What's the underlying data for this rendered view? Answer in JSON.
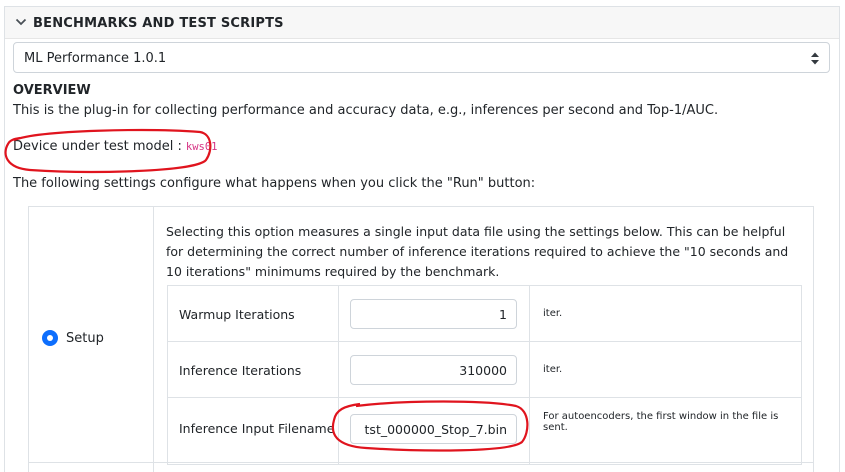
{
  "section": {
    "title": "BENCHMARKS AND TEST SCRIPTS",
    "chevron_icon": "chevron-down-icon"
  },
  "plugin_select": {
    "selected": "ML Performance 1.0.1",
    "arrows_icon": "sort-arrows-icon"
  },
  "overview": {
    "heading": "OVERVIEW",
    "description": "This is the plug-in for collecting performance and accuracy data, e.g., inferences per second and Top-1/AUC.",
    "dut_label": "Device under test model :",
    "dut_model": "kws01",
    "settings_intro": "The following settings configure what happens when you click the \"Run\" button:"
  },
  "annotation": {
    "color": "#e0141e"
  },
  "modes": {
    "setup": {
      "label": "Setup",
      "selected": true,
      "description": "Selecting this option measures a single input data file using the settings below. This can be helpful for determining the correct number of inference iterations required to achieve the \"10 seconds and 10 iterations\" minimums required by the benchmark.",
      "settings": [
        {
          "label": "Warmup Iterations",
          "value": "1",
          "unit": "iter.",
          "note": ""
        },
        {
          "label": "Inference Iterations",
          "value": "310000",
          "unit": "iter.",
          "note": ""
        },
        {
          "label": "Inference Input Filename",
          "value": "tst_000000_Stop_7.bin",
          "unit": "",
          "note": "For autoencoders, the first window in the file is sent."
        }
      ]
    }
  },
  "colors": {
    "accent": "#0d6efd",
    "code": "#d63384",
    "border": "#dee2e6",
    "header_bg": "#f7f7f7"
  }
}
